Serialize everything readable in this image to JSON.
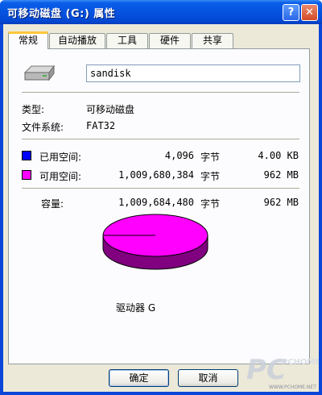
{
  "window": {
    "title": "可移动磁盘 (G:) 属性",
    "help_btn": "?",
    "close_btn": "✕"
  },
  "tabs": [
    {
      "label": "常规",
      "active": true
    },
    {
      "label": "自动播放",
      "active": false
    },
    {
      "label": "工具",
      "active": false
    },
    {
      "label": "硬件",
      "active": false
    },
    {
      "label": "共享",
      "active": false
    }
  ],
  "general": {
    "volume_name": "sandisk",
    "type_label": "类型:",
    "type_value": "可移动磁盘",
    "fs_label": "文件系统:",
    "fs_value": "FAT32",
    "used": {
      "label": "已用空间:",
      "bytes": "4,096",
      "unit": "字节",
      "human": "4.00 KB",
      "color": "#0000ff"
    },
    "free": {
      "label": "可用空间:",
      "bytes": "1,009,680,384",
      "unit": "字节",
      "human": "962 MB",
      "color": "#ff00ff"
    },
    "capacity": {
      "label": "容量:",
      "bytes": "1,009,684,480",
      "unit": "字节",
      "human": "962 MB"
    },
    "drive_label": "驱动器 G"
  },
  "buttons": {
    "ok": "确定",
    "cancel": "取消"
  },
  "watermark": {
    "brand_text": "PCHOME",
    "url": "WWW.PCHOME.NET"
  }
}
